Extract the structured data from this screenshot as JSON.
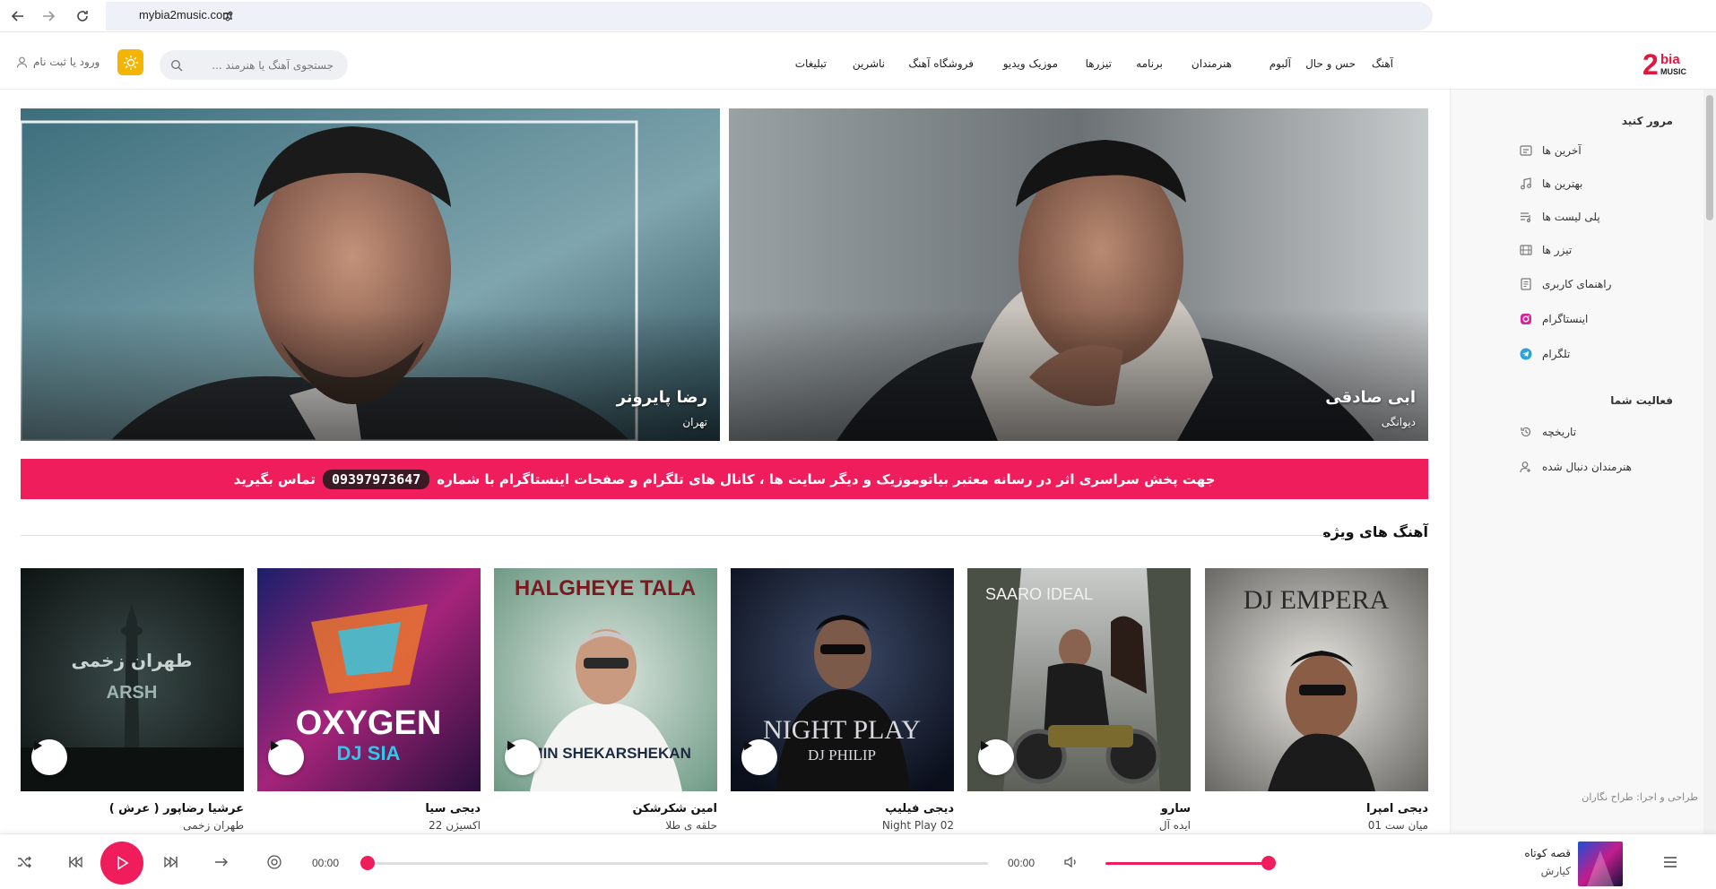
{
  "browser": {
    "url": "mybia2music.com"
  },
  "header": {
    "logo_text": "2bia MUSIC",
    "nav": [
      {
        "label": "آهنگ"
      },
      {
        "label": "حس و حال"
      },
      {
        "label": "آلبوم"
      },
      {
        "label": "هنرمندان"
      },
      {
        "label": "برنامه"
      },
      {
        "label": "تیزرها"
      },
      {
        "label": "موزیک ویدیو"
      },
      {
        "label": "فروشگاه آهنگ"
      },
      {
        "label": "ناشرین"
      },
      {
        "label": "تبلیغات"
      }
    ],
    "search_placeholder": "جستجوی آهنگ یا هنرمند ...",
    "login_label": "ورود یا ثبت نام"
  },
  "sidebar": {
    "browse_heading": "مرور کنید",
    "browse_items": [
      {
        "label": "آخرین ها",
        "icon": "latest-icon"
      },
      {
        "label": "بهترین ها",
        "icon": "music-note-icon"
      },
      {
        "label": "پلی لیست ها",
        "icon": "playlist-icon"
      },
      {
        "label": "تیزر ها",
        "icon": "film-icon"
      },
      {
        "label": "راهنمای کاربری",
        "icon": "guide-icon"
      },
      {
        "label": "اینستاگرام",
        "icon": "instagram-icon"
      },
      {
        "label": "تلگرام",
        "icon": "telegram-icon"
      }
    ],
    "activity_heading": "فعالیت شما",
    "activity_items": [
      {
        "label": "تاریخچه",
        "icon": "history-icon"
      },
      {
        "label": "هنرمندان دنبال شده",
        "icon": "follow-user-icon"
      }
    ],
    "footer": "طراحی و اجرا: طراح نگاران"
  },
  "banners": [
    {
      "title": "ابی صادقی",
      "subtitle": "دیوانگی"
    },
    {
      "title": "رضا پایرونر",
      "subtitle": "تهران"
    }
  ],
  "promo": {
    "text_before": "جهت پخش سراسری اثر در رسانه معتبر بیاتوموزیک و دیگر سایت ها ، کانال های تلگرام و صفحات اینستاگرام با شماره",
    "phone": "09397973647",
    "text_after": "تماس بگیرید"
  },
  "featured": {
    "heading": "آهنگ های ویژه",
    "cards": [
      {
        "artist": "دیجی امپرا",
        "title": "میان ست 01",
        "cover_text": "DJ EMPERA",
        "show_play": false
      },
      {
        "artist": "سارو",
        "title": "ایده آل",
        "cover_text": "SAARO IDEAL",
        "show_play": true
      },
      {
        "artist": "دیجی فیلیپ",
        "title": "Night Play 02",
        "cover_text": "NIGHT PLAY",
        "cover_sub": "DJ PHILIP",
        "show_play": true
      },
      {
        "artist": "امین شکرشکن",
        "title": "حلقه ی طلا",
        "cover_text": "HALGHEYE TALA",
        "cover_sub": "AMIN SHEKARSHEKAN",
        "show_play": true
      },
      {
        "artist": "دیجی سیا",
        "title": "اکسیژن 22",
        "cover_text": "OXYGEN",
        "cover_sub": "DJ SIA",
        "show_play": true
      },
      {
        "artist": "عرشیا رضاپور ( عرش )",
        "title": "طهران زخمی",
        "cover_text": "ARSH",
        "cover_sub": "طهران زخمی",
        "show_play": true
      }
    ]
  },
  "player": {
    "current_time": "00:00",
    "duration": "00:00",
    "progress": 0,
    "volume": 1.0,
    "now_playing_title": "قصه کوتاه",
    "now_playing_artist": "کیارش"
  },
  "colors": {
    "accent": "#f01d5c",
    "theme_button": "#f5b400"
  }
}
